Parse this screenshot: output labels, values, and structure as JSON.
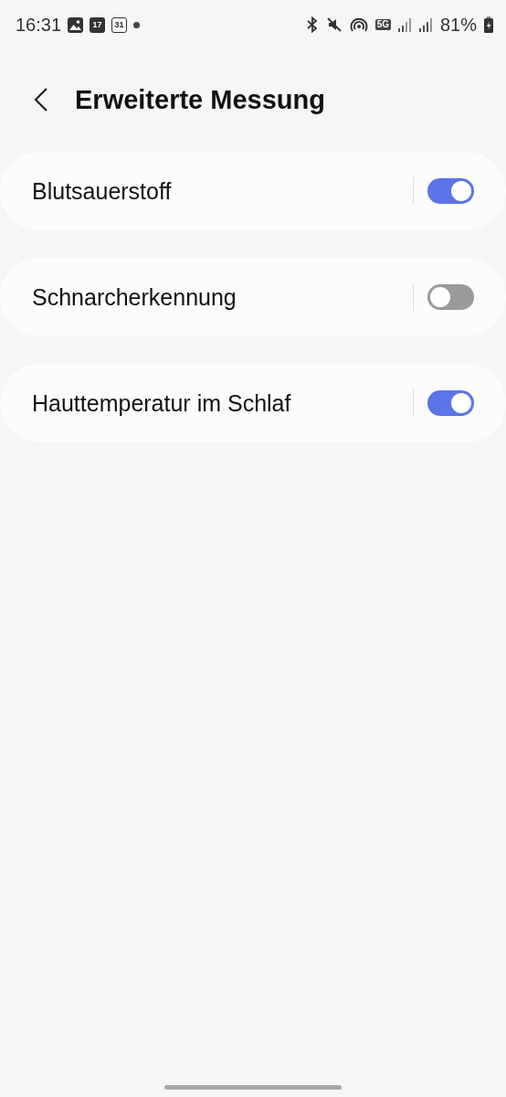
{
  "status_bar": {
    "time": "16:31",
    "calendar_day": "17",
    "date_day": "31",
    "battery": "81%",
    "network": "5G"
  },
  "header": {
    "title": "Erweiterte Messung"
  },
  "settings": [
    {
      "label": "Blutsauerstoff",
      "on": true
    },
    {
      "label": "Schnarcherkennung",
      "on": false
    },
    {
      "label": "Hauttemperatur im Schlaf",
      "on": true
    }
  ]
}
